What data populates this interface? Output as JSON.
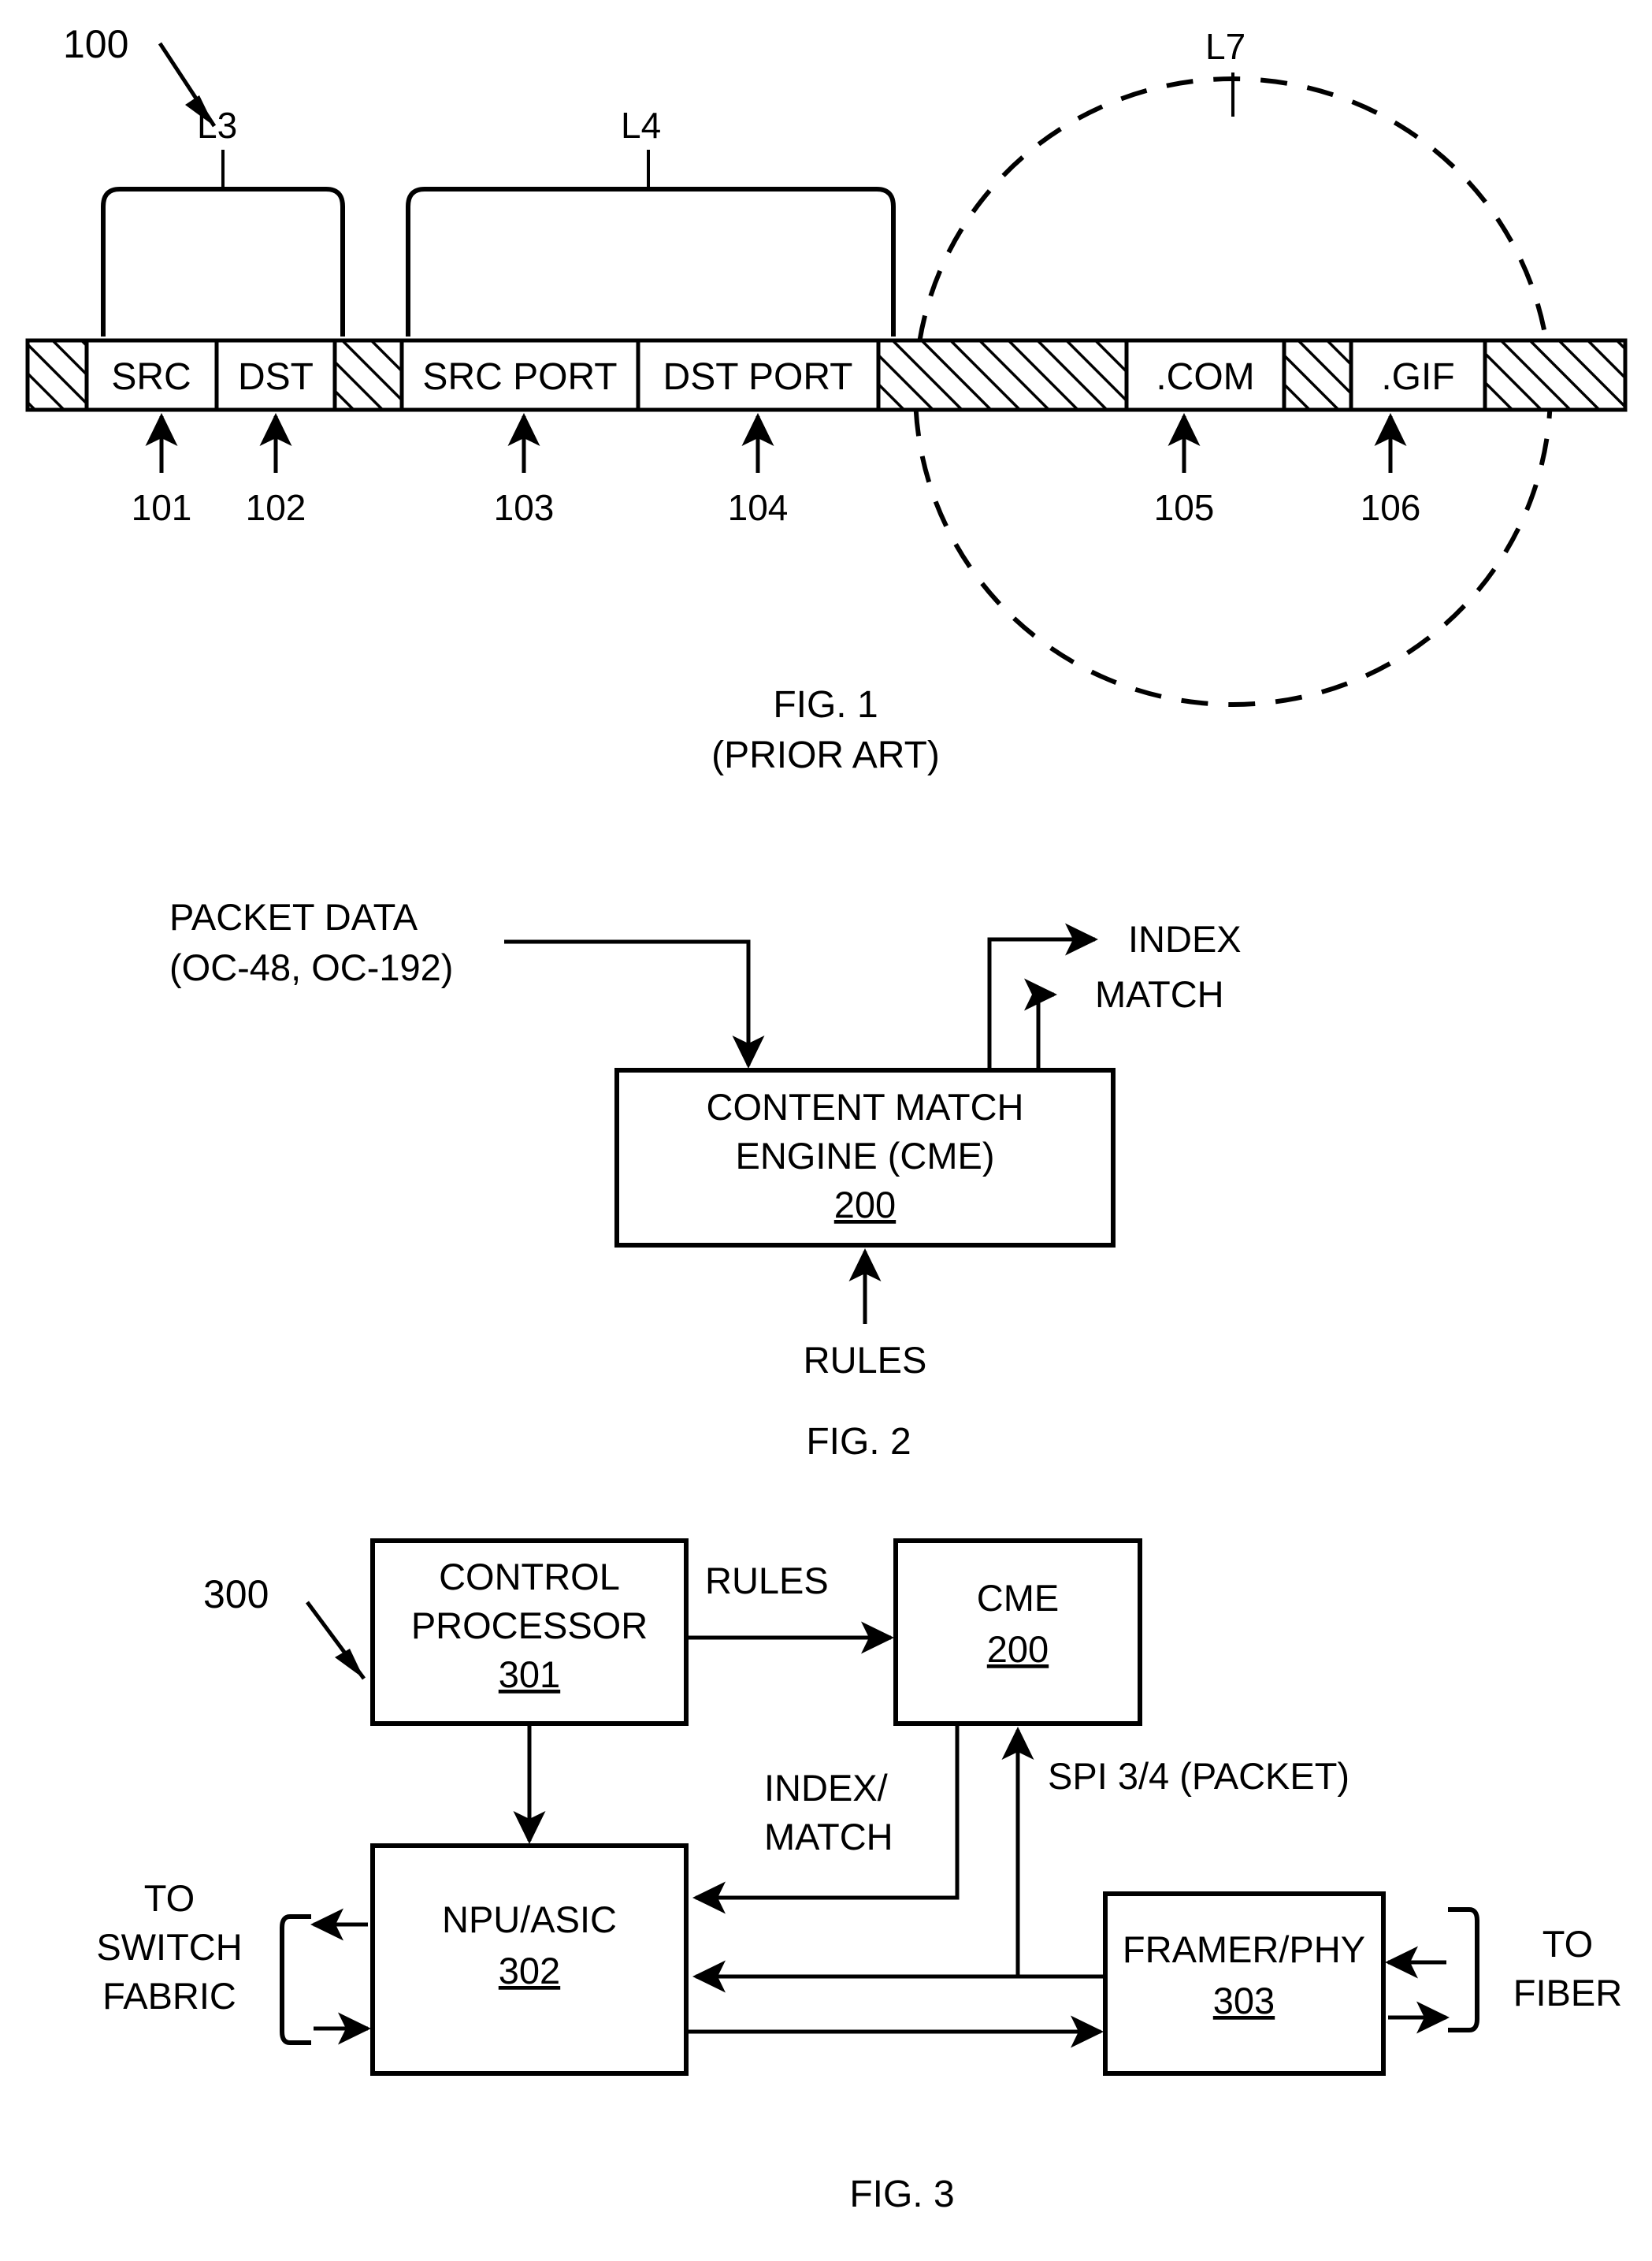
{
  "document": {
    "type": "patent-figure-sheet"
  },
  "figure1": {
    "ref_label": "100",
    "bracket_l3": "L3",
    "bracket_l4": "L4",
    "ellipse_label": "L7",
    "packet_segments": [
      {
        "label": "",
        "hatched": true
      },
      {
        "label": "SRC",
        "hatched": false
      },
      {
        "label": "DST",
        "hatched": false
      },
      {
        "label": "",
        "hatched": true
      },
      {
        "label": "SRC PORT",
        "hatched": false
      },
      {
        "label": "DST PORT",
        "hatched": false
      },
      {
        "label": "",
        "hatched": true
      },
      {
        "label": ".COM",
        "hatched": false
      },
      {
        "label": "",
        "hatched": true
      },
      {
        "label": ".GIF",
        "hatched": false
      },
      {
        "label": "",
        "hatched": true
      }
    ],
    "callouts": [
      {
        "number": "101",
        "target": "SRC"
      },
      {
        "number": "102",
        "target": "DST"
      },
      {
        "number": "103",
        "target": "SRC PORT"
      },
      {
        "number": "104",
        "target": "DST PORT"
      },
      {
        "number": "105",
        "target": ".COM"
      },
      {
        "number": "106",
        "target": ".GIF"
      }
    ],
    "caption_line1": "FIG. 1",
    "caption_line2": "(PRIOR ART)"
  },
  "figure2": {
    "input_label_line1": "PACKET DATA",
    "input_label_line2": "(OC-48, OC-192)",
    "output_index": "INDEX",
    "output_match": "MATCH",
    "rules_label": "RULES",
    "block": {
      "line1": "CONTENT MATCH",
      "line2": "ENGINE (CME)",
      "number": "200"
    },
    "caption": "FIG. 2"
  },
  "figure3": {
    "ref_label": "300",
    "blocks": {
      "control_processor": {
        "line1": "CONTROL",
        "line2": "PROCESSOR",
        "number": "301"
      },
      "cme": {
        "line1": "CME",
        "number": "200"
      },
      "npu_asic": {
        "line1": "NPU/ASIC",
        "number": "302"
      },
      "framer_phy": {
        "line1": "FRAMER/PHY",
        "number": "303"
      }
    },
    "signals": {
      "rules": "RULES",
      "index_match_line1": "INDEX/",
      "index_match_line2": "MATCH",
      "spi": "SPI 3/4 (PACKET)"
    },
    "side_labels": {
      "switch_fabric_line1": "TO",
      "switch_fabric_line2": "SWITCH",
      "switch_fabric_line3": "FABRIC",
      "fiber_line1": "TO",
      "fiber_line2": "FIBER"
    },
    "caption": "FIG. 3"
  }
}
